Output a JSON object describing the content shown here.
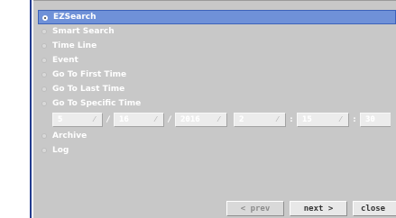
{
  "search_options": [
    {
      "label": "EZSearch",
      "selected": true
    },
    {
      "label": "Smart Search",
      "selected": false
    },
    {
      "label": "Time Line",
      "selected": false
    },
    {
      "label": "Event",
      "selected": false
    },
    {
      "label": "Go To First Time",
      "selected": false
    },
    {
      "label": "Go To Last Time",
      "selected": false
    },
    {
      "label": "Go To Specific Time",
      "selected": false
    }
  ],
  "specific_time": {
    "month": "5",
    "day": "16",
    "year": "2016",
    "hour": "2",
    "minute": "15",
    "second": "30",
    "date_separator": "/",
    "time_separator": ":"
  },
  "more_options": [
    {
      "label": "Archive",
      "selected": false
    },
    {
      "label": "Log",
      "selected": false
    }
  ],
  "buttons": {
    "prev": "< prev",
    "next": "next >",
    "close": "close"
  },
  "colors": {
    "panel_bg": "#c8c8c8",
    "selected_bg": "#6f91d8",
    "frame_border": "#233c8f"
  }
}
